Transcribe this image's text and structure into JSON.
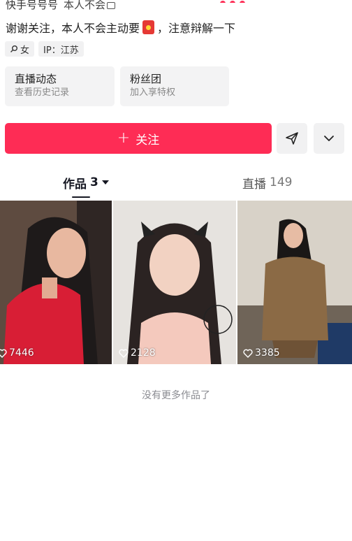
{
  "profile": {
    "id_label": "快手号号号",
    "id_value": "本人不会",
    "bio_before": "谢谢关注，本人不会主动要",
    "bio_after": "，注意辩解一下",
    "gender": "女",
    "ip": "IP：江苏"
  },
  "cards": [
    {
      "title": "直播动态",
      "subtitle": "查看历史记录"
    },
    {
      "title": "粉丝团",
      "subtitle": "加入享特权"
    }
  ],
  "actions": {
    "follow_label": "关注"
  },
  "tabs": {
    "works_label": "作品",
    "works_count": "3",
    "live_label": "直播",
    "live_count": "149"
  },
  "videos": [
    {
      "likes": "7446"
    },
    {
      "likes": "2128"
    },
    {
      "likes": "3385"
    }
  ],
  "end_text": "没有更多作品了",
  "colors": {
    "accent": "#fe2c55",
    "chip_bg": "#f1f1f2"
  },
  "icons": [
    "search-icon",
    "red-envelope-icon",
    "plus-icon",
    "share-icon",
    "chevron-down-icon",
    "heart-icon"
  ]
}
